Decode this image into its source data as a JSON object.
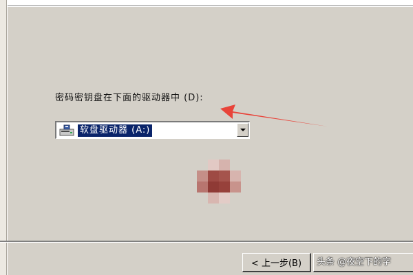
{
  "dialog": {
    "field_label": "密码密钥盘在下面的驱动器中 (D):",
    "combo": {
      "selected_value": "软盘驱动器 (A:)",
      "icon": "floppy-drive-icon"
    }
  },
  "buttons": {
    "back_label": "< 上一步(B)"
  },
  "watermark": {
    "text": "头条 @夜空下的字"
  },
  "colors": {
    "dialog_background": "#d4d0c8",
    "selection_highlight": "#0a246a",
    "annotation_arrow": "#e8443a"
  }
}
